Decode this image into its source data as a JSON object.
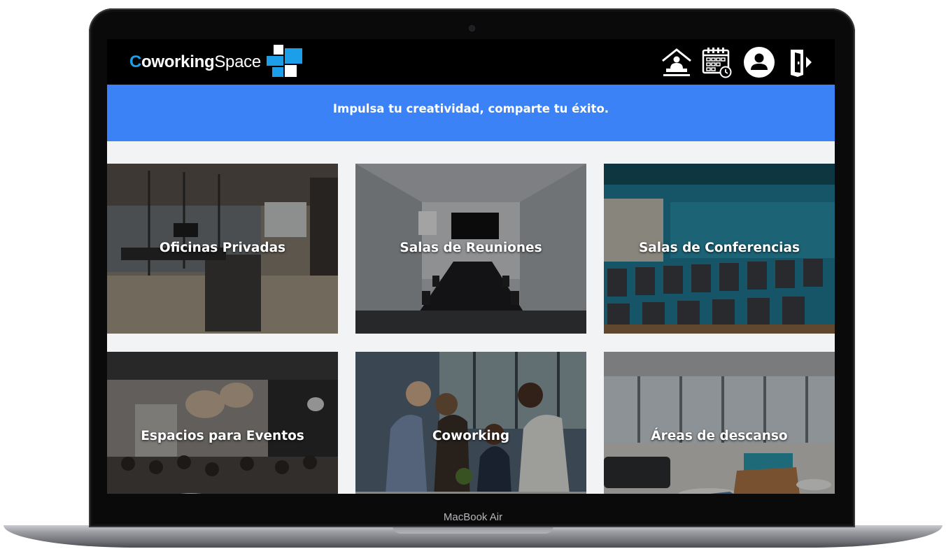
{
  "device": {
    "model_label": "MacBook Air"
  },
  "header": {
    "logo": {
      "part1": "C",
      "part2": "oworking",
      "part3": "Space"
    },
    "icons": [
      "reception-icon",
      "calendar-icon",
      "user-icon",
      "logout-icon"
    ]
  },
  "banner": {
    "tagline": "Impulsa tu creatividad, comparte tu éxito."
  },
  "spaces": [
    {
      "title": "Oficinas Privadas",
      "icon": "office-photo"
    },
    {
      "title": "Salas de Reuniones",
      "icon": "meeting-room-photo"
    },
    {
      "title": "Salas de Conferencias",
      "icon": "conference-room-photo"
    },
    {
      "title": "Espacios para Eventos",
      "icon": "event-space-photo"
    },
    {
      "title": "Coworking",
      "icon": "coworking-photo"
    },
    {
      "title": "Áreas de descanso",
      "icon": "lounge-photo"
    }
  ],
  "colors": {
    "accent": "#3b82f6",
    "logo_blue": "#1c9ee8",
    "navbar": "#000000",
    "page_bg": "#f2f3f5"
  }
}
